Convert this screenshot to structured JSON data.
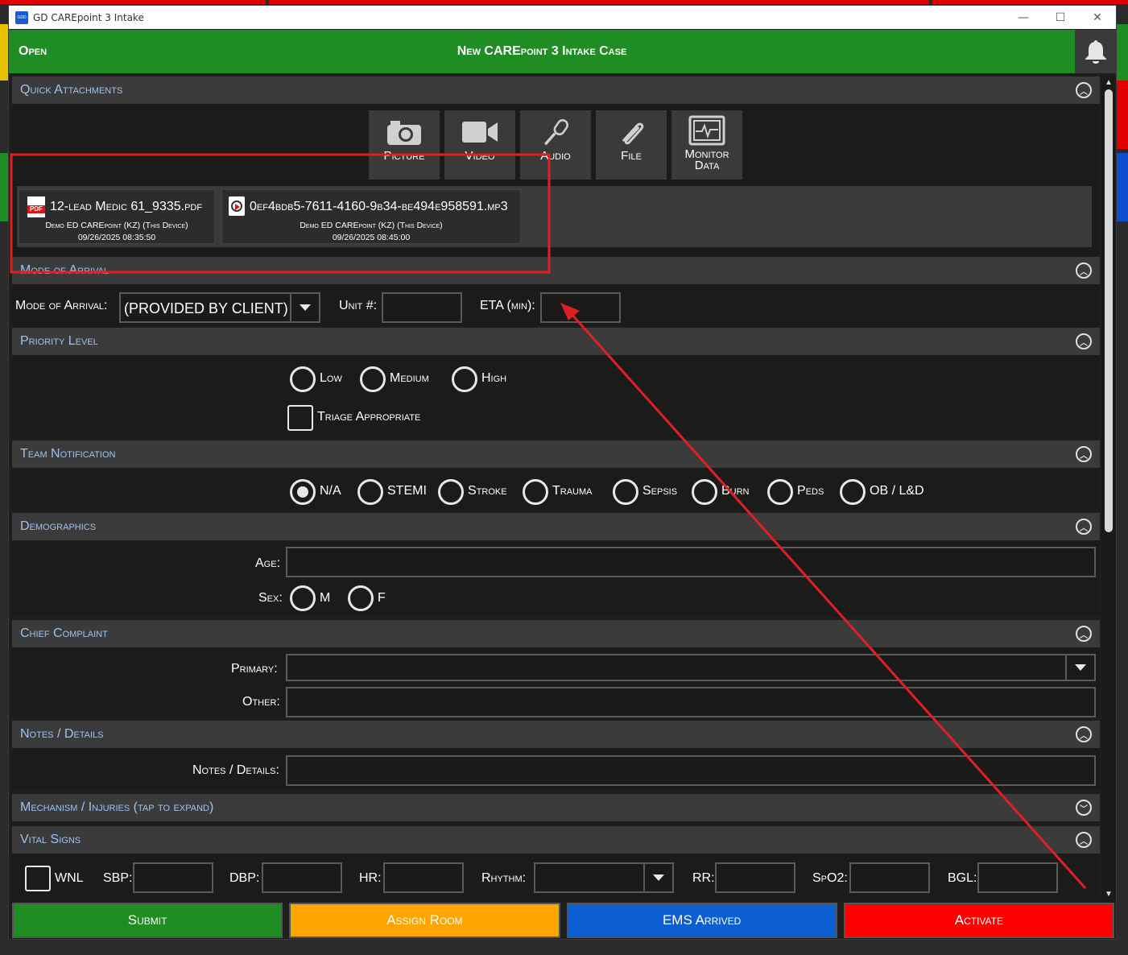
{
  "window": {
    "title": "GD CAREpoint 3 Intake",
    "logo_text": "GDD",
    "minimize": "—",
    "maximize": "☐",
    "close": "✕"
  },
  "header": {
    "status": "Open",
    "title": "New CAREpoint 3 Intake Case"
  },
  "quick_attachments": {
    "title": "Quick Attachments",
    "buttons": [
      {
        "label": "Picture",
        "icon": "camera-icon"
      },
      {
        "label": "Video",
        "icon": "video-camera-icon"
      },
      {
        "label": "Audio",
        "icon": "microphone-icon"
      },
      {
        "label": "File",
        "icon": "paperclip-icon"
      },
      {
        "label": "Monitor",
        "label2": "Data",
        "icon": "monitor-icon"
      }
    ],
    "files": [
      {
        "name": "12-lead Medic 61_9335.pdf",
        "source": "Demo ED CAREpoint (KZ) (This Device)",
        "timestamp": "09/26/2025 08:35:50",
        "icon": "pdf-icon",
        "icon_text": "PDF"
      },
      {
        "name": "0ef4bdb5-7611-4160-9b34-be494e958591.mp3",
        "source": "Demo ED CAREpoint (KZ) (This Device)",
        "timestamp": "09/26/2025 08:45:00",
        "icon": "audio-file-icon"
      }
    ]
  },
  "mode_of_arrival": {
    "title": "Mode of Arrival",
    "mode_label": "Mode of Arrival:",
    "mode_value": "(PROVIDED BY CLIENT)",
    "unit_label": "Unit #:",
    "unit_value": "",
    "eta_label": "ETA (min):",
    "eta_value": ""
  },
  "priority_level": {
    "title": "Priority Level",
    "options": [
      "Low",
      "Medium",
      "High"
    ],
    "triage_label": "Triage Appropriate"
  },
  "team_notification": {
    "title": "Team Notification",
    "options": [
      "N/A",
      "STEMI",
      "Stroke",
      "Trauma",
      "Sepsis",
      "Burn",
      "Peds",
      "OB / L&D"
    ],
    "selected": "N/A"
  },
  "demographics": {
    "title": "Demographics",
    "age_label": "Age:",
    "age_value": "",
    "sex_label": "Sex:",
    "sex_options": [
      "M",
      "F"
    ]
  },
  "chief_complaint": {
    "title": "Chief Complaint",
    "primary_label": "Primary:",
    "primary_value": "",
    "other_label": "Other:",
    "other_value": ""
  },
  "notes": {
    "title": "Notes / Details",
    "label": "Notes / Details:",
    "value": ""
  },
  "mechanism": {
    "title": "Mechanism / Injuries (tap to expand)"
  },
  "vital_signs": {
    "title": "Vital Signs",
    "wnl_label": "WNL",
    "fields": [
      "SBP:",
      "DBP:",
      "HR:",
      "Rhythm:",
      "RR:",
      "SpO2:",
      "BGL:"
    ]
  },
  "footer": {
    "submit": "Submit",
    "assign_room": "Assign Room",
    "ems_arrived": "EMS Arrived",
    "activate": "Activate"
  },
  "colors": {
    "header_green": "#1f8c24",
    "submit_green": "#1f8c24",
    "assign_orange": "#ffa500",
    "ems_blue": "#0d5fd1",
    "activate_red": "#ff0000",
    "section_title": "#9cc3f0",
    "annotation_red": "#e02020"
  }
}
